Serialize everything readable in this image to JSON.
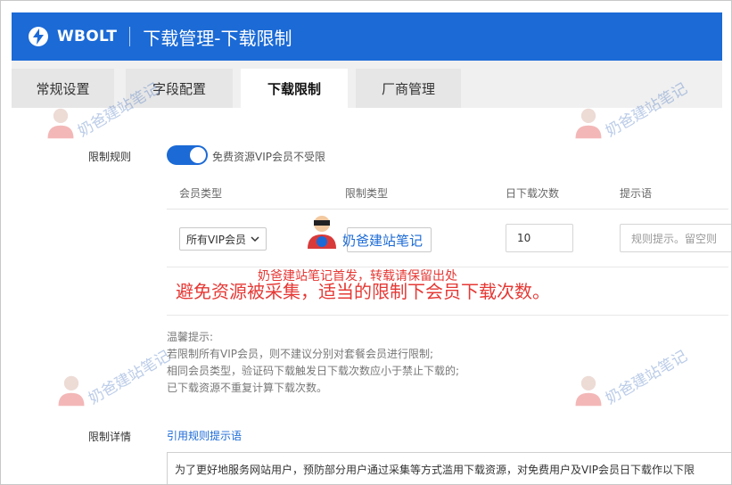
{
  "header": {
    "brand": "WBOLT",
    "title": "下载管理-下载限制",
    "logo_icon": "lightning-bolt-icon",
    "bg_color": "#1b6ad6"
  },
  "tabs": [
    {
      "label": "常规设置",
      "active": false
    },
    {
      "label": "字段配置",
      "active": false
    },
    {
      "label": "下载限制",
      "active": true
    },
    {
      "label": "厂商管理",
      "active": false
    }
  ],
  "rules": {
    "label": "限制规则",
    "toggle_text": "免费资源VIP会员不受限",
    "toggle_on": true,
    "columns": [
      "会员类型",
      "限制类型",
      "日下载次数",
      "提示语"
    ],
    "row": {
      "member_type": "所有VIP会员",
      "daily_count": "10",
      "tip_placeholder": "规则提示。留空则"
    }
  },
  "tips": {
    "title": "温馨提示:",
    "lines": [
      "若限制所有VIP会员，则不建议分别对套餐会员进行限制;",
      "相同会员类型，验证码下载触发日下载次数应小于禁止下载的;",
      "已下载资源不重复计算下载次数。"
    ]
  },
  "detail": {
    "label": "限制详情",
    "link": "引用规则提示语",
    "text": "为了更好地服务网站用户，预防部分用户通过采集等方式滥用下载资源，对免费用户及VIP会员日下载作以下限"
  },
  "annotations": {
    "main": "避免资源被采集，适当的限制下会员下载次数。",
    "small": "奶爸建站笔记首发，转载请保留出处",
    "center_watermark": "奶爸建站笔记",
    "watermark": "奶爸建站笔记"
  }
}
